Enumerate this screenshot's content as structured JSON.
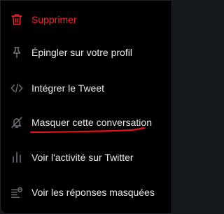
{
  "menu": {
    "items": [
      {
        "label": "Supprimer",
        "icon": "trash-icon"
      },
      {
        "label": "Épingler sur votre profil",
        "icon": "pin-icon"
      },
      {
        "label": "Intégrer le Tweet",
        "icon": "code-icon"
      },
      {
        "label": "Masquer cette conversation",
        "icon": "mute-icon"
      },
      {
        "label": "Voir l'activité sur Twitter",
        "icon": "activity-icon"
      },
      {
        "label": "Voir les réponses masquées",
        "icon": "hidden-replies-icon"
      }
    ]
  },
  "colors": {
    "background": "#000000",
    "text": "#e7e9ea",
    "icon": "#71767b",
    "danger": "#f4212e",
    "annotation": "#e0101d"
  }
}
